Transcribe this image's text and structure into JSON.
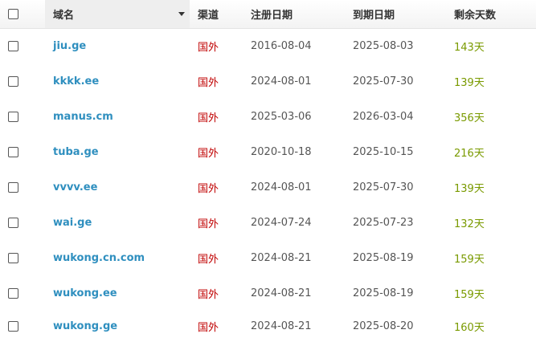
{
  "header": {
    "domain": "域名",
    "channel": "渠道",
    "registered": "注册日期",
    "expires": "到期日期",
    "remaining": "剩余天数"
  },
  "rows": [
    {
      "domain": "jiu.ge",
      "channel": "国外",
      "registered": "2016-08-04",
      "expires": "2025-08-03",
      "remaining": "143天"
    },
    {
      "domain": "kkkk.ee",
      "channel": "国外",
      "registered": "2024-08-01",
      "expires": "2025-07-30",
      "remaining": "139天"
    },
    {
      "domain": "manus.cm",
      "channel": "国外",
      "registered": "2025-03-06",
      "expires": "2026-03-04",
      "remaining": "356天"
    },
    {
      "domain": "tuba.ge",
      "channel": "国外",
      "registered": "2020-10-18",
      "expires": "2025-10-15",
      "remaining": "216天"
    },
    {
      "domain": "vvvv.ee",
      "channel": "国外",
      "registered": "2024-08-01",
      "expires": "2025-07-30",
      "remaining": "139天"
    },
    {
      "domain": "wai.ge",
      "channel": "国外",
      "registered": "2024-07-24",
      "expires": "2025-07-23",
      "remaining": "132天"
    },
    {
      "domain": "wukong.cn.com",
      "channel": "国外",
      "registered": "2024-08-21",
      "expires": "2025-08-19",
      "remaining": "159天"
    },
    {
      "domain": "wukong.ee",
      "channel": "国外",
      "registered": "2024-08-21",
      "expires": "2025-08-19",
      "remaining": "159天"
    },
    {
      "domain": "wukong.ge",
      "channel": "国外",
      "registered": "2024-08-21",
      "expires": "2025-08-20",
      "remaining": "160天"
    }
  ],
  "colors": {
    "domain_link": "#2f8fbf",
    "channel": "#c00000",
    "remaining_days": "#7a9a00"
  }
}
